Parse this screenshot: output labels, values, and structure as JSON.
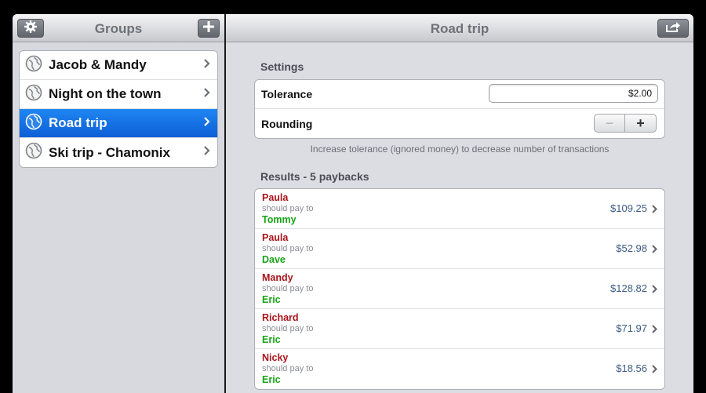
{
  "left": {
    "title": "Groups",
    "groups": [
      {
        "label": "Jacob & Mandy",
        "selected": false
      },
      {
        "label": "Night on the town",
        "selected": false
      },
      {
        "label": "Road trip",
        "selected": true
      },
      {
        "label": "Ski trip - Chamonix",
        "selected": false
      }
    ]
  },
  "right": {
    "title": "Road trip",
    "settings": {
      "heading": "Settings",
      "tolerance_label": "Tolerance",
      "tolerance_value": "$2.00",
      "rounding_label": "Rounding",
      "stepper_minus": "−",
      "stepper_plus": "+",
      "hint": "Increase tolerance (ignored money) to decrease number of transactions"
    },
    "results": {
      "heading": "Results - 5 paybacks",
      "should_pay_text": "should pay to",
      "rows": [
        {
          "payer": "Paula",
          "payee": "Tommy",
          "amount": "$109.25"
        },
        {
          "payer": "Paula",
          "payee": "Dave",
          "amount": "$52.98"
        },
        {
          "payer": "Mandy",
          "payee": "Eric",
          "amount": "$128.82"
        },
        {
          "payer": "Richard",
          "payee": "Eric",
          "amount": "$71.97"
        },
        {
          "payer": "Nicky",
          "payee": "Eric",
          "amount": "$18.56"
        }
      ]
    }
  },
  "icons": {
    "settings": "gear-icon",
    "add": "plus-icon",
    "share": "share-icon",
    "group": "globe-icon",
    "disclosure": "chevron-right-icon"
  },
  "colors": {
    "selected_row": "#0d6fe5",
    "payer": "#a9151b",
    "payee": "#16a316",
    "amount": "#3c5c86"
  }
}
